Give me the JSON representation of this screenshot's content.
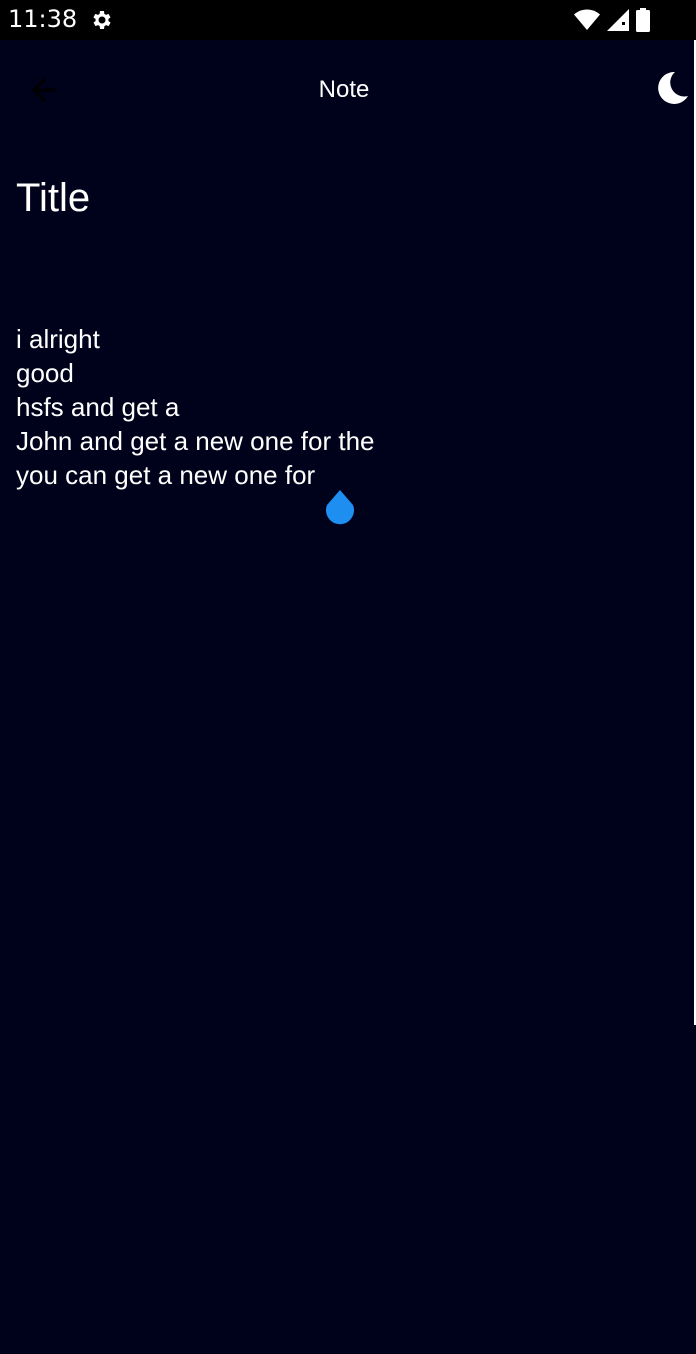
{
  "status_bar": {
    "time": "11:38",
    "icons": [
      "gear-icon",
      "wifi-icon",
      "signal-icon",
      "battery-icon"
    ]
  },
  "app_bar": {
    "title": "Note",
    "back_icon": "back-arrow-icon",
    "theme_icon": "moon-icon"
  },
  "note": {
    "title": "Title",
    "lines": [
      "i alright",
      "good",
      "hsfs and get a",
      "John and get a new one for the",
      "you can get a new one for"
    ]
  },
  "colors": {
    "background": "#00011a",
    "text": "#ffffff",
    "accent": "#1e8ef0"
  }
}
